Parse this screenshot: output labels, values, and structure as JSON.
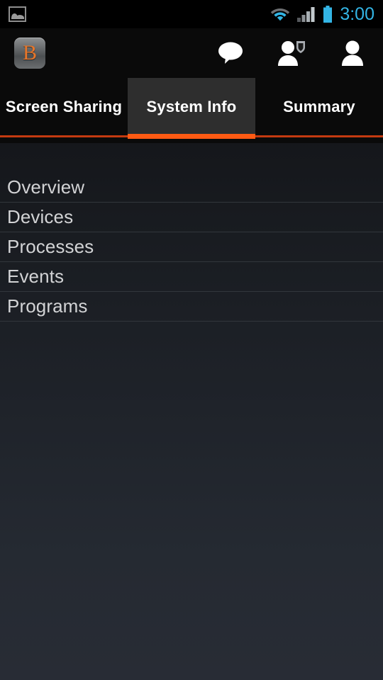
{
  "status_bar": {
    "notification_icon": "gallery-icon",
    "wifi_icon": "wifi-icon",
    "signal_icon": "cell-signal-icon",
    "battery_icon": "battery-icon",
    "time": "3:00",
    "accent_color": "#33b5e5"
  },
  "action_bar": {
    "app_logo_letter": "B",
    "app_logo_name": "app-logo",
    "actions": [
      {
        "name": "chat-icon",
        "label": "Chat"
      },
      {
        "name": "person-shield-icon",
        "label": "Supporter"
      },
      {
        "name": "person-icon",
        "label": "Customer"
      }
    ]
  },
  "tabs": {
    "items": [
      {
        "label": "Screen Sharing",
        "active": false
      },
      {
        "label": "System Info",
        "active": true
      },
      {
        "label": "Summary",
        "active": false
      }
    ],
    "active_index": 1,
    "indicator_color": "#ff5a13",
    "indicator_dim_color": "#c33a10",
    "active_tab_bg": "#2e2e2e"
  },
  "list": {
    "items": [
      {
        "label": "Overview"
      },
      {
        "label": "Devices"
      },
      {
        "label": "Processes"
      },
      {
        "label": "Events"
      },
      {
        "label": "Programs"
      }
    ],
    "text_color": "#d2d3d5",
    "divider_color": "#32363c"
  },
  "colors": {
    "background_top": "#0e0f11",
    "background_bottom": "#282c35",
    "bar_background": "#0a0a0a",
    "brand_orange": "#e8762a"
  }
}
